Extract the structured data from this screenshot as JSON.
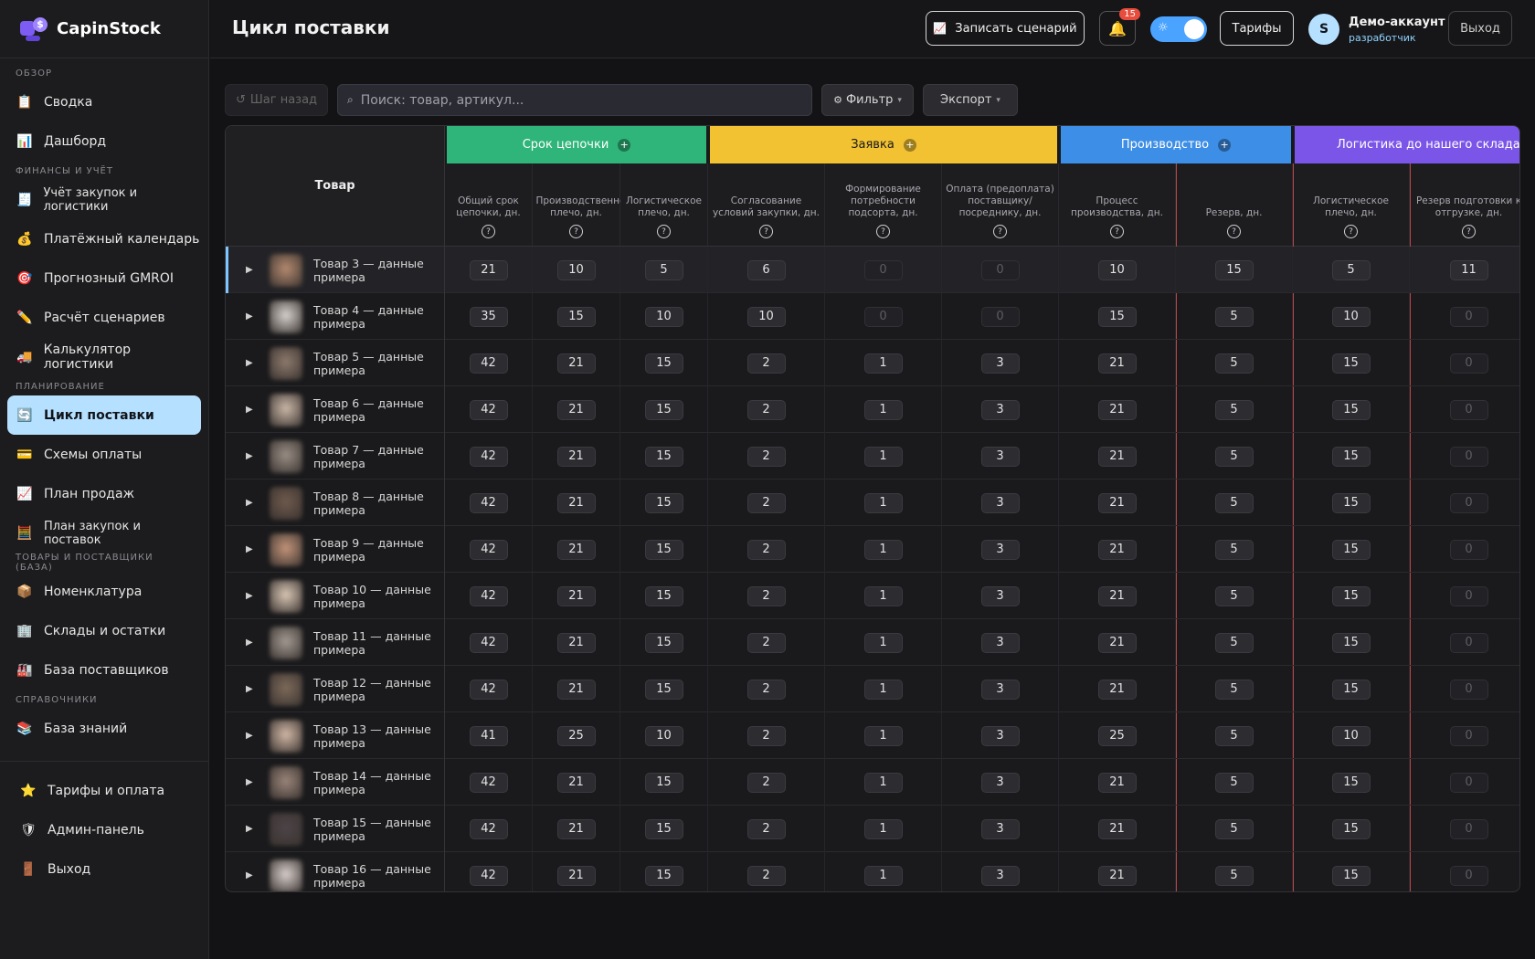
{
  "app": {
    "name": "CapinStock"
  },
  "sidebar": {
    "sections": [
      {
        "label": "ОБЗОР",
        "items": [
          {
            "label": "Сводка",
            "icon": "clipboard-icon"
          },
          {
            "label": "Дашборд",
            "icon": "bar-chart-icon"
          }
        ]
      },
      {
        "label": "ФИНАНСЫ И УЧЁТ",
        "items": [
          {
            "label": "Учёт закупок и логистики",
            "icon": "receipt-icon"
          },
          {
            "label": "Платёжный календарь",
            "icon": "money-bag-icon"
          },
          {
            "label": "Прогнозный GMROI",
            "icon": "target-icon"
          },
          {
            "label": "Расчёт сценариев",
            "icon": "pencil-icon"
          },
          {
            "label": "Калькулятор логистики",
            "icon": "truck-icon"
          }
        ]
      },
      {
        "label": "ПЛАНИРОВАНИЕ",
        "items": [
          {
            "label": "Цикл поставки",
            "icon": "cycle-icon",
            "active": true
          },
          {
            "label": "Схемы оплаты",
            "icon": "credit-card-icon"
          },
          {
            "label": "План продаж",
            "icon": "trend-chart-icon"
          },
          {
            "label": "План закупок и поставок",
            "icon": "abacus-icon"
          }
        ]
      },
      {
        "label": "ТОВАРЫ И ПОСТАВЩИКИ (БАЗА)",
        "items": [
          {
            "label": "Номенклатура",
            "icon": "package-icon"
          },
          {
            "label": "Склады и остатки",
            "icon": "buildings-icon"
          },
          {
            "label": "База поставщиков",
            "icon": "factory-icon"
          }
        ]
      },
      {
        "label": "СПРАВОЧНИКИ",
        "items": [
          {
            "label": "База знаний",
            "icon": "books-icon"
          }
        ]
      }
    ],
    "footer": [
      {
        "label": "Тарифы и оплата",
        "icon": "star-icon"
      },
      {
        "label": "Админ-панель",
        "icon": "shield-icon"
      },
      {
        "label": "Выход",
        "icon": "door-icon"
      }
    ]
  },
  "header": {
    "title": "Цикл поставки",
    "record_label": "Записать сценарий",
    "notif_count": "15",
    "tariffs_label": "Тарифы",
    "avatar_letter": "S",
    "user_name": "Демо-аккаунт",
    "user_role": "разработчик",
    "logout_label": "Выход"
  },
  "toolbar": {
    "back_label": "Шаг назад",
    "search_placeholder": "Поиск: товар, артикул...",
    "filter_label": "Фильтр",
    "export_label": "Экспорт"
  },
  "table": {
    "product_header": "Товар",
    "groups": [
      {
        "label": "Срок цепочки",
        "color": "#2fb57a",
        "text_color": "#ffffff"
      },
      {
        "label": "Заявка",
        "color": "#f2c232",
        "text_color": "#1a1a1a"
      },
      {
        "label": "Производство",
        "color": "#3d8ee6",
        "text_color": "#ffffff"
      },
      {
        "label": "Логистика до нашего склада / фу",
        "color": "#7b55e8",
        "text_color": "#ffffff"
      }
    ],
    "columns": [
      "Общий срок цепочки, дн.",
      "Производственное плечо, дн.",
      "Логистическое плечо, дн.",
      "Согласование условий закупки, дн.",
      "Формирование потребности подсорта, дн.",
      "Оплата (предоплата) поставщику/ посреднику, дн.",
      "Процесс производства, дн.",
      "Резерв, дн.",
      "Логистическое плечо, дн.",
      "Резерв подготовки к отгрузке, дн."
    ],
    "rows": [
      {
        "name": "Товар 3 — данные примера",
        "values": [
          21,
          10,
          5,
          6,
          0,
          0,
          10,
          15,
          5,
          11
        ]
      },
      {
        "name": "Товар 4 — данные примера",
        "values": [
          35,
          15,
          10,
          10,
          0,
          0,
          15,
          5,
          10,
          0
        ]
      },
      {
        "name": "Товар 5 — данные примера",
        "values": [
          42,
          21,
          15,
          2,
          1,
          3,
          21,
          5,
          15,
          0
        ]
      },
      {
        "name": "Товар 6 — данные примера",
        "values": [
          42,
          21,
          15,
          2,
          1,
          3,
          21,
          5,
          15,
          0
        ]
      },
      {
        "name": "Товар 7 — данные примера",
        "values": [
          42,
          21,
          15,
          2,
          1,
          3,
          21,
          5,
          15,
          0
        ]
      },
      {
        "name": "Товар 8 — данные примера",
        "values": [
          42,
          21,
          15,
          2,
          1,
          3,
          21,
          5,
          15,
          0
        ]
      },
      {
        "name": "Товар 9 — данные примера",
        "values": [
          42,
          21,
          15,
          2,
          1,
          3,
          21,
          5,
          15,
          0
        ]
      },
      {
        "name": "Товар 10 — данные примера",
        "values": [
          42,
          21,
          15,
          2,
          1,
          3,
          21,
          5,
          15,
          0
        ]
      },
      {
        "name": "Товар 11 — данные примера",
        "values": [
          42,
          21,
          15,
          2,
          1,
          3,
          21,
          5,
          15,
          0
        ]
      },
      {
        "name": "Товар 12 — данные примера",
        "values": [
          42,
          21,
          15,
          2,
          1,
          3,
          21,
          5,
          15,
          0
        ]
      },
      {
        "name": "Товар 13 — данные примера",
        "values": [
          41,
          25,
          10,
          2,
          1,
          3,
          25,
          5,
          10,
          0
        ]
      },
      {
        "name": "Товар 14 — данные примера",
        "values": [
          42,
          21,
          15,
          2,
          1,
          3,
          21,
          5,
          15,
          0
        ]
      },
      {
        "name": "Товар 15 — данные примера",
        "values": [
          42,
          21,
          15,
          2,
          1,
          3,
          21,
          5,
          15,
          0
        ]
      },
      {
        "name": "Товар 16 — данные примера",
        "values": [
          42,
          21,
          15,
          2,
          1,
          3,
          21,
          5,
          15,
          0
        ]
      }
    ]
  }
}
